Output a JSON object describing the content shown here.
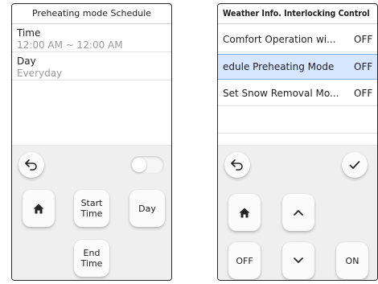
{
  "left_screen": {
    "title": "Preheating mode Schedule",
    "fields": [
      {
        "title": "Time",
        "value": "12:00 AM ~ 12:00 AM"
      },
      {
        "title": "Day",
        "value": "Everyday"
      }
    ],
    "toggle_state": "off",
    "buttons": {
      "start_time": "Start Time",
      "day": "Day",
      "end_time": "End Time"
    },
    "icons": [
      "back-icon",
      "home-icon"
    ]
  },
  "right_screen": {
    "title": "Weather Info. Interlocking Control",
    "rows": [
      {
        "label": "Comfort Operation wi...",
        "state": "OFF",
        "selected": false
      },
      {
        "label": "edule  Preheating Mode",
        "state": "OFF",
        "selected": true
      },
      {
        "label": "Set Snow Removal Mo...",
        "state": "OFF",
        "selected": false
      }
    ],
    "buttons": {
      "off": "OFF",
      "on": "ON"
    },
    "icons": [
      "back-icon",
      "check-icon",
      "home-icon",
      "chevron-up-icon",
      "chevron-down-icon"
    ]
  },
  "colors": {
    "selected_row_bg": "#d6e6ff",
    "selected_row_border": "#7eaeea",
    "panel_bg": "#efefef"
  }
}
